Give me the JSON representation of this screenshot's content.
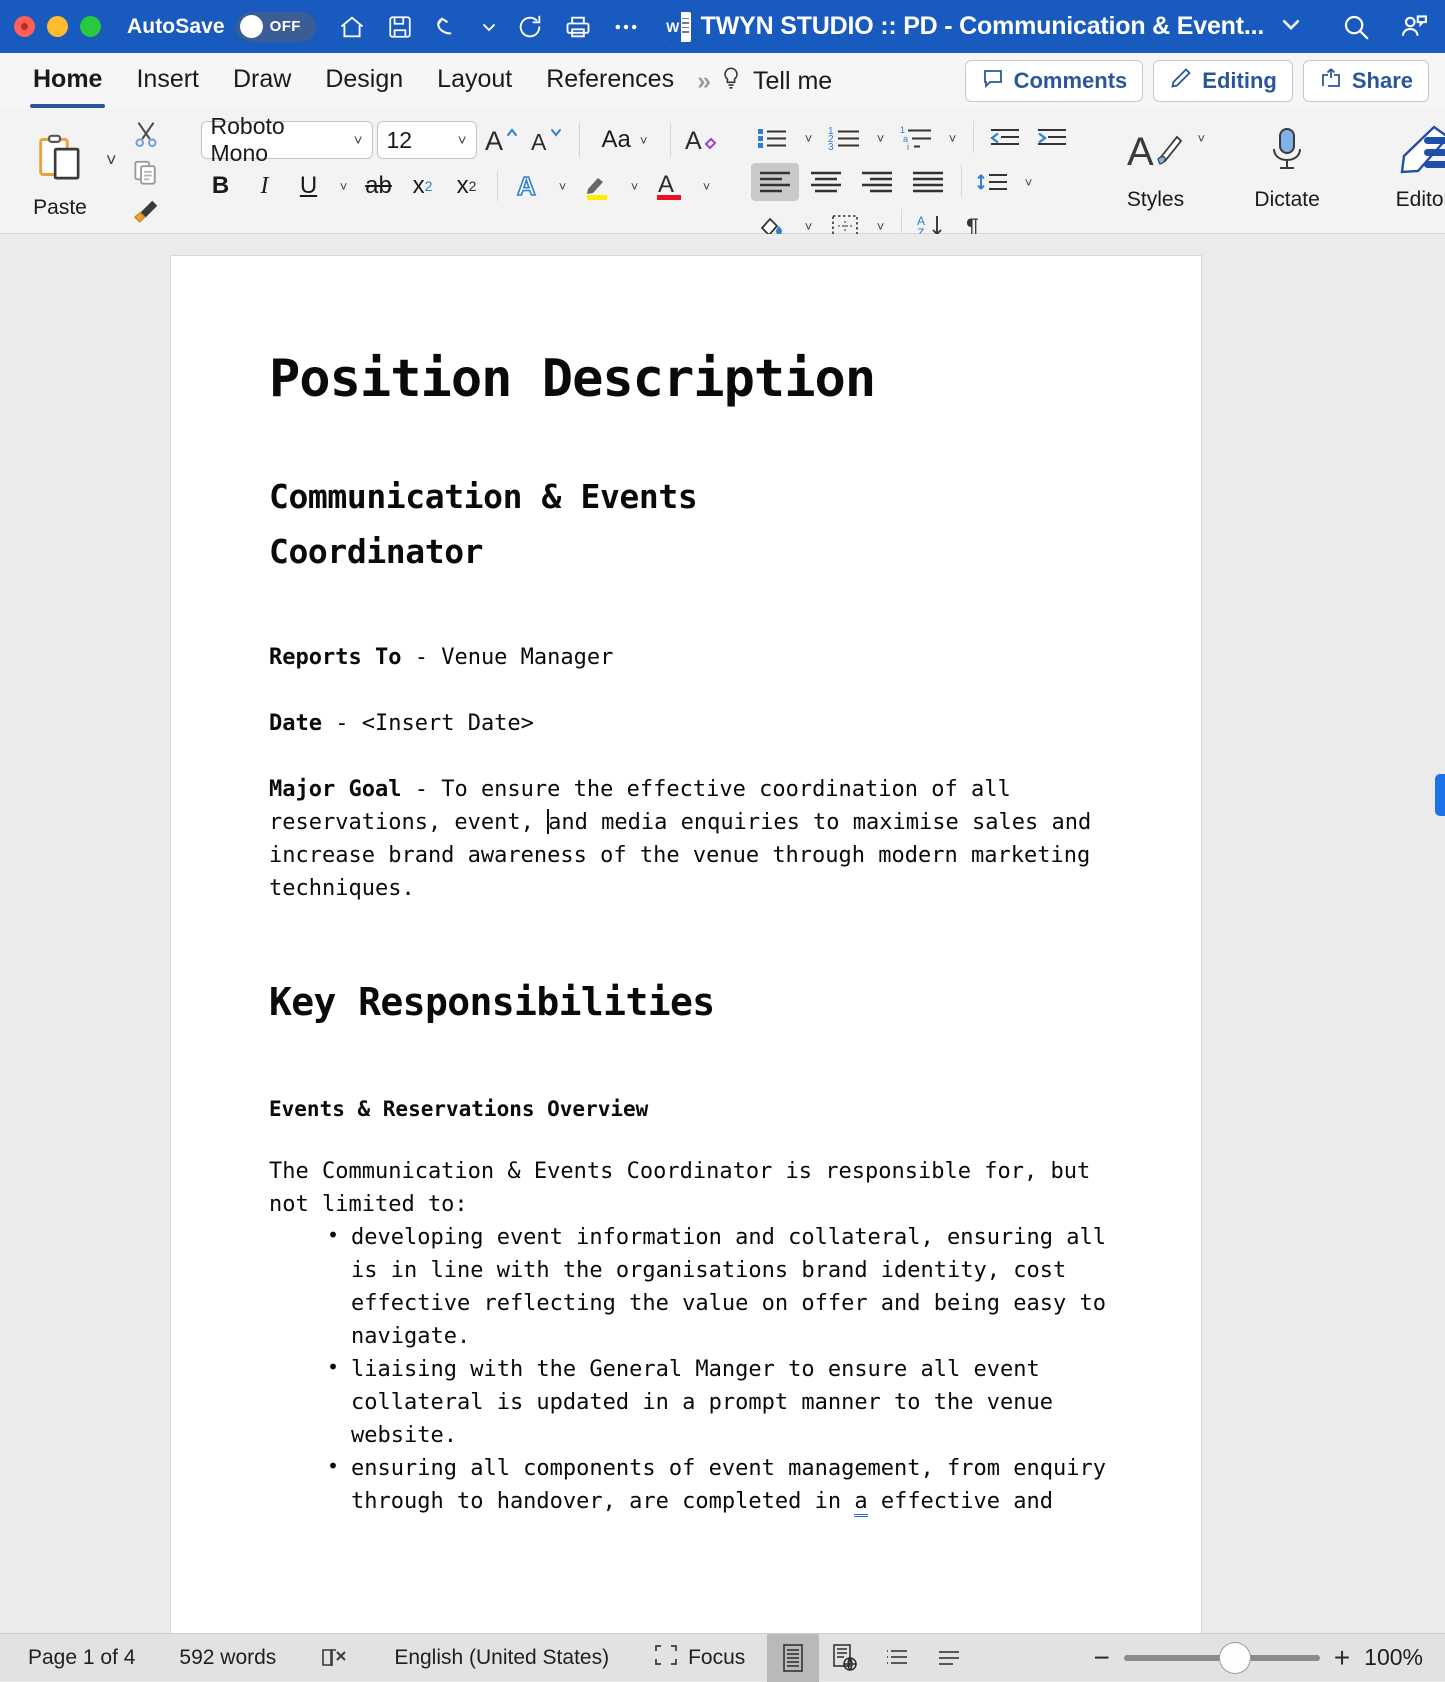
{
  "titlebar": {
    "autosave_label": "AutoSave",
    "autosave_state": "OFF",
    "doc_title": "TWYN STUDIO :: PD - Communication & Event...",
    "icons": [
      "home-icon",
      "save-icon",
      "undo-icon",
      "redo-icon",
      "print-icon",
      "more-icon"
    ],
    "right_icons": [
      "search-icon",
      "people-icon"
    ],
    "accent": "#185abd"
  },
  "ribbon_tabs": {
    "tabs": [
      "Home",
      "Insert",
      "Draw",
      "Design",
      "Layout",
      "References"
    ],
    "active": "Home",
    "overflow": "»",
    "tell_me": "Tell me",
    "comments": "Comments",
    "editing": "Editing",
    "share": "Share"
  },
  "ribbon": {
    "paste_label": "Paste",
    "font_name": "Roboto Mono",
    "font_size": "12",
    "styles_label": "Styles",
    "dictate_label": "Dictate",
    "editor_label": "Editor",
    "bold": "B",
    "italic": "I",
    "underline": "U",
    "strikethrough": "ab",
    "subscript": "x",
    "subscript_num": "2",
    "superscript": "x",
    "superscript_num": "2",
    "change_case": "Aa"
  },
  "document": {
    "h1": "Position Description",
    "h2_line1": "Communication & Events",
    "h2_line2": "Coordinator",
    "reports_to_label": "Reports To",
    "reports_to_sep": " - ",
    "reports_to_value": "Venue Manager",
    "date_label": "Date",
    "date_sep": " - ",
    "date_value": "<Insert Date>",
    "major_goal_label": "Major Goal",
    "major_goal_sep": " - ",
    "major_goal_text_a": "To ensure the effective coordination of all reservations, event, ",
    "major_goal_text_b": "and media enquiries to maximise sales and increase brand awareness of the venue through modern marketing techniques.",
    "key_responsibilities_heading": "Key Responsibilities",
    "subheading": "Events & Reservations Overview",
    "intro": "The Communication & Events Coordinator is responsible for, but not limited to:",
    "bullets": [
      "developing event information and collateral, ensuring all is in line with the organisations brand identity, cost effective reflecting the value on offer and being easy to navigate.",
      "liaising with the General Manger to ensure all event collateral is updated in a prompt manner to the venue website."
    ],
    "bullet3_a": "ensuring all components of event management, from enquiry through to handover, are completed in ",
    "bullet3_grammar": "a",
    "bullet3_b": " effective and"
  },
  "statusbar": {
    "page": "Page 1 of 4",
    "words": "592 words",
    "proofing_icon": "proofing-errors-icon",
    "language": "English (United States)",
    "focus": "Focus",
    "views": [
      "print-layout-view-icon",
      "web-layout-view-icon",
      "outline-view-icon",
      "draft-view-icon"
    ],
    "zoom_minus": "−",
    "zoom_plus": "+",
    "zoom_level": "100%"
  }
}
